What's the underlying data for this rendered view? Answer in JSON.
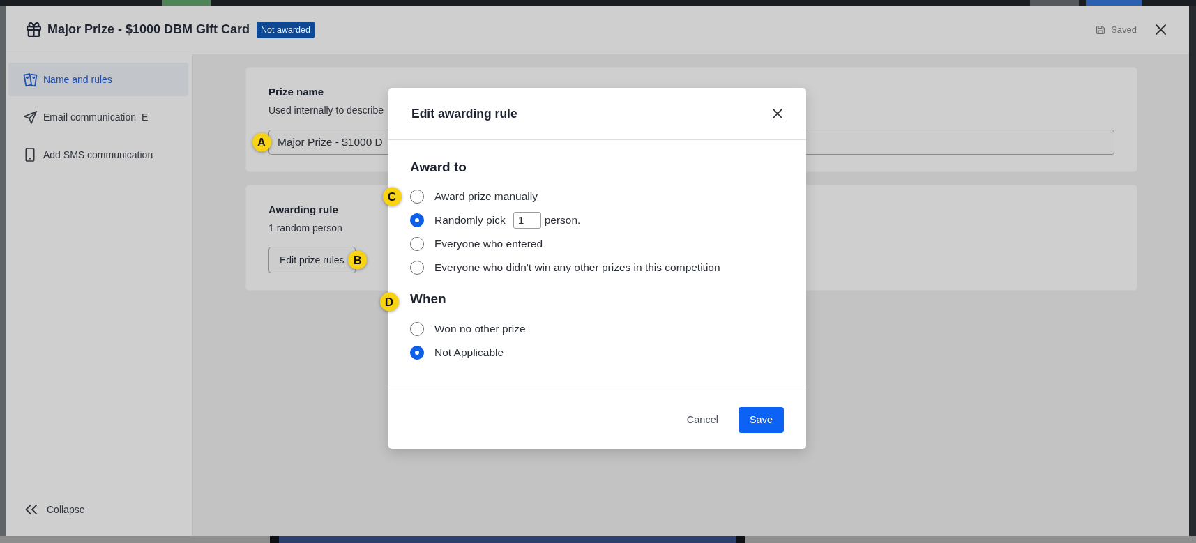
{
  "header": {
    "title": "Major Prize - $1000 DBM Gift Card",
    "status": "Not awarded",
    "save_status": "Saved"
  },
  "sidebar": {
    "items": [
      {
        "label": "Name and rules",
        "selected": true
      },
      {
        "label": "Email communication",
        "selected": false,
        "marker": "E"
      },
      {
        "label": "Add SMS communication",
        "selected": false
      }
    ],
    "collapse": "Collapse"
  },
  "sections": [
    {
      "kind": "text_field",
      "title": "Prize name",
      "description": "Used internally to describe",
      "value": "Major Prize - $1000 D",
      "marker": "A"
    },
    {
      "kind": "button",
      "title": "Awarding rule",
      "description": "1 random person",
      "button": "Edit prize rules",
      "marker": "B"
    }
  ],
  "dialog": {
    "title": "Edit awarding rule",
    "groups": [
      {
        "heading": "Award to",
        "options": [
          {
            "kind": "plain",
            "label": "Award prize manually",
            "selected": false,
            "marker": "C"
          },
          {
            "kind": "count",
            "label": "Randomly pick",
            "value": "1",
            "suffix": "person.",
            "selected": true
          },
          {
            "kind": "plain",
            "label": "Everyone who entered",
            "selected": false
          },
          {
            "kind": "plain",
            "label": "Everyone who didn't win any other prizes in this competition",
            "selected": false
          }
        ]
      },
      {
        "heading": "When",
        "marker": "D",
        "options": [
          {
            "kind": "plain",
            "label": "Won no other prize",
            "selected": false
          },
          {
            "kind": "plain",
            "label": "Not Applicable",
            "selected": true
          }
        ]
      }
    ],
    "buttons": [
      {
        "kind": "secondary",
        "label": "Cancel"
      },
      {
        "kind": "primary",
        "label": "Save"
      }
    ]
  }
}
